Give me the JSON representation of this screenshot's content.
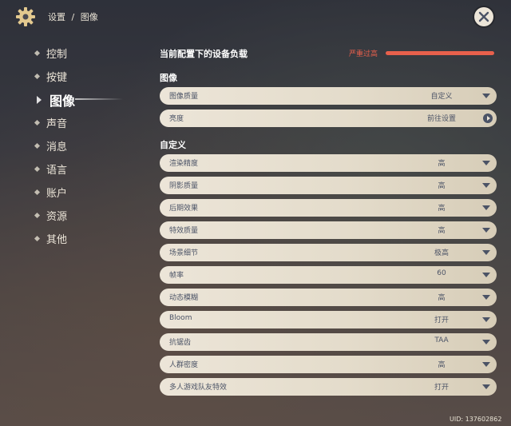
{
  "header": {
    "breadcrumb": [
      "设置",
      "/",
      "图像"
    ],
    "settings_icon": "gear-icon",
    "close_icon": "close-icon"
  },
  "sidebar": {
    "items": [
      {
        "label": "控制",
        "active": false
      },
      {
        "label": "按键",
        "active": false
      },
      {
        "label": "图像",
        "active": true
      },
      {
        "label": "声音",
        "active": false
      },
      {
        "label": "消息",
        "active": false
      },
      {
        "label": "语言",
        "active": false
      },
      {
        "label": "账户",
        "active": false
      },
      {
        "label": "资源",
        "active": false
      },
      {
        "label": "其他",
        "active": false
      }
    ]
  },
  "load": {
    "label": "当前配置下的设备负载",
    "status": "严重过高",
    "status_color": "#e8604c"
  },
  "graphics": {
    "section_title": "图像",
    "quality": {
      "label": "图像质量",
      "value": "自定义"
    },
    "brightness": {
      "label": "亮度",
      "value": "前往设置"
    }
  },
  "custom": {
    "section_title": "自定义",
    "rows": [
      {
        "label": "渲染精度",
        "value": "高"
      },
      {
        "label": "阴影质量",
        "value": "高"
      },
      {
        "label": "后期效果",
        "value": "高"
      },
      {
        "label": "特效质量",
        "value": "高"
      },
      {
        "label": "场景细节",
        "value": "极高"
      },
      {
        "label": "帧率",
        "value": "60"
      },
      {
        "label": "动态模糊",
        "value": "高"
      },
      {
        "label": "Bloom",
        "value": "打开"
      },
      {
        "label": "抗锯齿",
        "value": "TAA"
      },
      {
        "label": "人群密度",
        "value": "高"
      },
      {
        "label": "多人游戏队友特效",
        "value": "打开"
      }
    ]
  },
  "footer": {
    "uid": "UID: 137602862"
  }
}
